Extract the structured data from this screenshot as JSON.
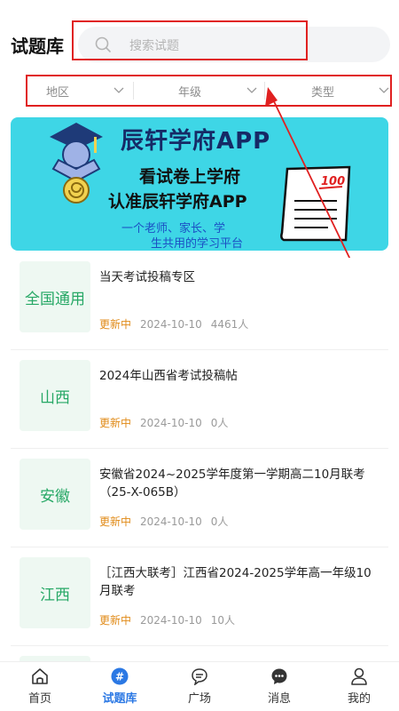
{
  "header": {
    "title": "试题库",
    "search": {
      "placeholder": "搜索试题",
      "icon": "search-icon"
    }
  },
  "filters": [
    {
      "label": "地区",
      "icon": "chevron-down-icon"
    },
    {
      "label": "年级",
      "icon": "chevron-down-icon"
    },
    {
      "label": "类型",
      "icon": "chevron-down-icon"
    }
  ],
  "banner": {
    "title": "辰轩学府APP",
    "line1": "看试卷上学府",
    "line2": "认准辰轩学府APP",
    "sub1": "一个老师、家长、学",
    "sub2": "生共用的学习平台",
    "badge": "100"
  },
  "items": [
    {
      "region": "全国通用",
      "title": "当天考试投稿专区",
      "status": "更新中",
      "date": "2024-10-10",
      "count": "4461人"
    },
    {
      "region": "山西",
      "title": "2024年山西省考试投稿帖",
      "status": "更新中",
      "date": "2024-10-10",
      "count": "0人"
    },
    {
      "region": "安徽",
      "title": "安徽省2024~2025学年度第一学期高二10月联考（25-X-065B）",
      "status": "更新中",
      "date": "2024-10-10",
      "count": "0人"
    },
    {
      "region": "江西",
      "title": "［江西大联考］江西省2024-2025学年高一年级10月联考",
      "status": "更新中",
      "date": "2024-10-10",
      "count": "10人"
    }
  ],
  "nav": [
    {
      "label": "首页",
      "icon": "home-icon",
      "active": false
    },
    {
      "label": "试题库",
      "icon": "hash-icon",
      "active": true
    },
    {
      "label": "广场",
      "icon": "chat-bubble-icon",
      "active": false
    },
    {
      "label": "消息",
      "icon": "message-icon",
      "active": false
    },
    {
      "label": "我的",
      "icon": "user-icon",
      "active": false
    }
  ],
  "colors": {
    "accent": "#2b78e4",
    "status": "#e08a17",
    "region_text": "#27a866",
    "banner_bg": "#3ed6e6",
    "annotation": "#e02020"
  }
}
